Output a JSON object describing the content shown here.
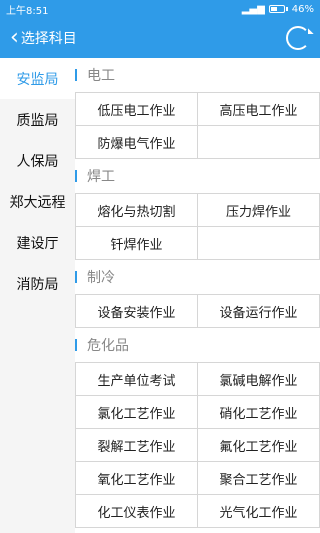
{
  "status": {
    "time": "上午8:51",
    "battery": "46%"
  },
  "appbar": {
    "back_icon": "chevron-left-icon",
    "title": "选择科目",
    "refresh_icon": "refresh-icon"
  },
  "sidebar": {
    "items": [
      {
        "label": "安监局",
        "active": true
      },
      {
        "label": "质监局"
      },
      {
        "label": "人保局"
      },
      {
        "label": "郑大远程"
      },
      {
        "label": "建设厅"
      },
      {
        "label": "消防局"
      }
    ]
  },
  "sections": [
    {
      "title": "电工",
      "items": [
        "低压电工作业",
        "高压电工作业",
        "防爆电气作业",
        ""
      ]
    },
    {
      "title": "焊工",
      "items": [
        "熔化与热切割",
        "压力焊作业",
        "钎焊作业",
        ""
      ]
    },
    {
      "title": "制冷",
      "items": [
        "设备安装作业",
        "设备运行作业"
      ]
    },
    {
      "title": "危化品",
      "items": [
        "生产单位考试",
        "氯碱电解作业",
        "氯化工艺作业",
        "硝化工艺作业",
        "裂解工艺作业",
        "氟化工艺作业",
        "氧化工艺作业",
        "聚合工艺作业",
        "化工仪表作业",
        "光气化工作业"
      ]
    }
  ]
}
